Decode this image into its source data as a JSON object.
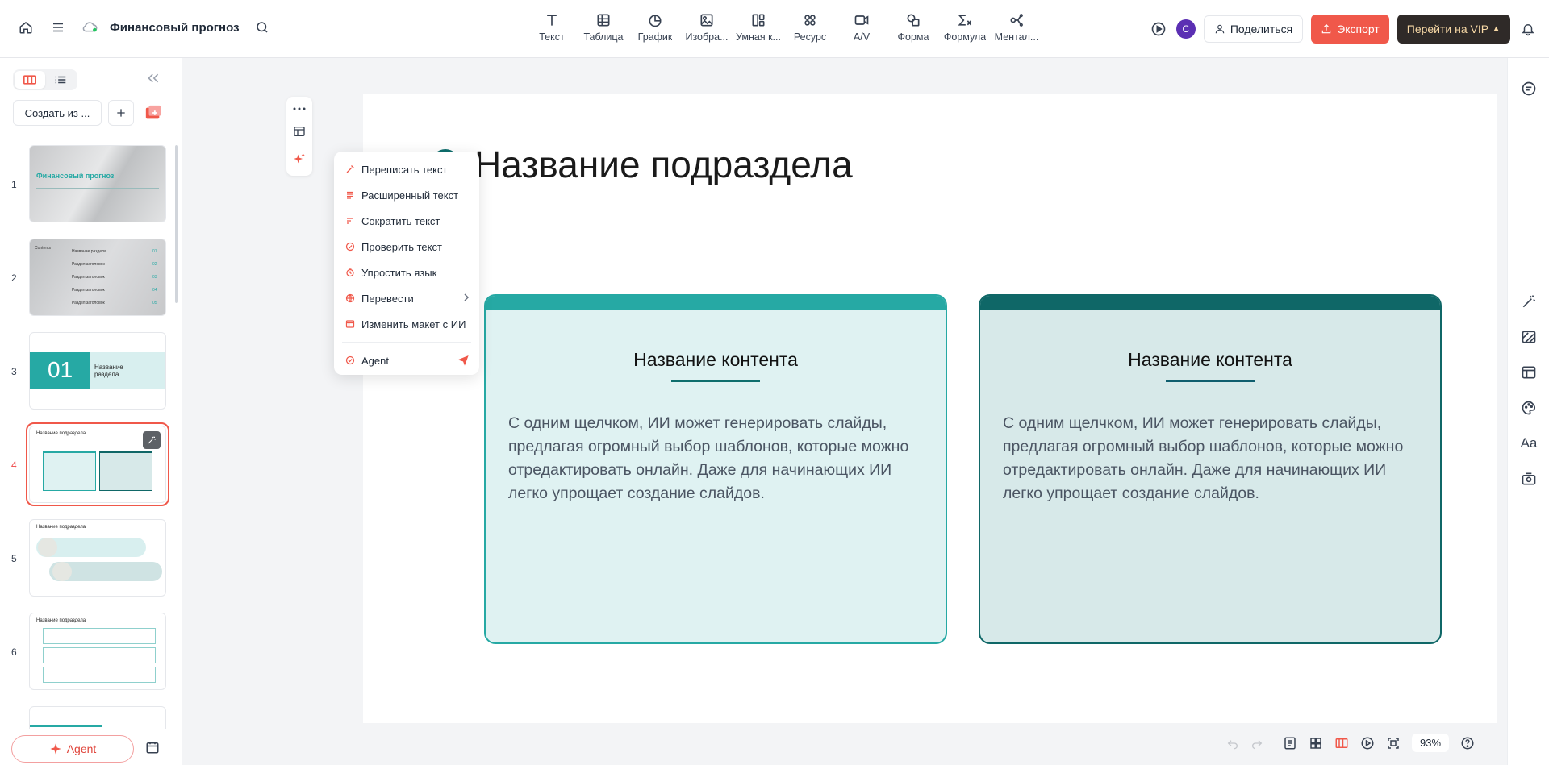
{
  "header": {
    "doc_title": "Финансовый прогноз",
    "tools": [
      {
        "label": "Текст",
        "icon": "text-icon"
      },
      {
        "label": "Таблица",
        "icon": "table-icon"
      },
      {
        "label": "График",
        "icon": "chart-icon"
      },
      {
        "label": "Изобра...",
        "icon": "image-icon"
      },
      {
        "label": "Умная к...",
        "icon": "smart-layout-icon"
      },
      {
        "label": "Ресурс",
        "icon": "resource-icon"
      },
      {
        "label": "A/V",
        "icon": "video-icon"
      },
      {
        "label": "Форма",
        "icon": "shape-icon"
      },
      {
        "label": "Формула",
        "icon": "formula-icon"
      },
      {
        "label": "Ментал...",
        "icon": "mindmap-icon"
      }
    ],
    "avatar_letter": "C",
    "share_label": "Поделиться",
    "export_label": "Экспорт",
    "vip_label": "Перейти на VIP"
  },
  "sidebar": {
    "create_label": "Создать из ...",
    "agent_label": "Agent",
    "slides": [
      {
        "num": "1",
        "title": "Финансовый прогноз"
      },
      {
        "num": "2",
        "title": "Contents",
        "items": [
          "Название раздела",
          "Раздел заголовок",
          "Раздел заголовок",
          "Раздел заголовок",
          "Раздел заголовок"
        ],
        "nums": [
          "01",
          "02",
          "03",
          "04",
          "05"
        ]
      },
      {
        "num": "3",
        "big": "01",
        "title": "Название раздела"
      },
      {
        "num": "4",
        "title": "Название подраздела"
      },
      {
        "num": "5",
        "title": "Название подраздела"
      },
      {
        "num": "6",
        "title": "Название подраздела"
      }
    ]
  },
  "slide": {
    "title": "Название подраздела",
    "cards": [
      {
        "title": "Название контента",
        "body": "С одним щелчком, ИИ может генерировать слайды, предлагая огромный выбор шаблонов, которые можно отредактировать онлайн. Даже для начинающих ИИ легко упрощает создание слайдов."
      },
      {
        "title": "Название контента",
        "body": "С одним щелчком, ИИ может генерировать слайды, предлагая огромный выбор шаблонов, которые можно отредактировать онлайн. Даже для начинающих ИИ легко упрощает создание слайдов."
      }
    ]
  },
  "context_menu": {
    "items": [
      {
        "label": "Переписать текст",
        "icon": "rewrite-icon"
      },
      {
        "label": "Расширенный текст",
        "icon": "expand-text-icon"
      },
      {
        "label": "Сократить текст",
        "icon": "shorten-text-icon"
      },
      {
        "label": "Проверить текст",
        "icon": "check-text-icon"
      },
      {
        "label": "Упростить язык",
        "icon": "simplify-icon"
      },
      {
        "label": "Перевести",
        "icon": "translate-icon"
      },
      {
        "label": "Изменить макет с ИИ",
        "icon": "ai-layout-icon"
      }
    ],
    "agent_label": "Agent"
  },
  "status": {
    "zoom": "93%"
  },
  "colors": {
    "accent": "#f0584a",
    "teal": "#26a9a4",
    "dark_teal": "#0f6767"
  }
}
